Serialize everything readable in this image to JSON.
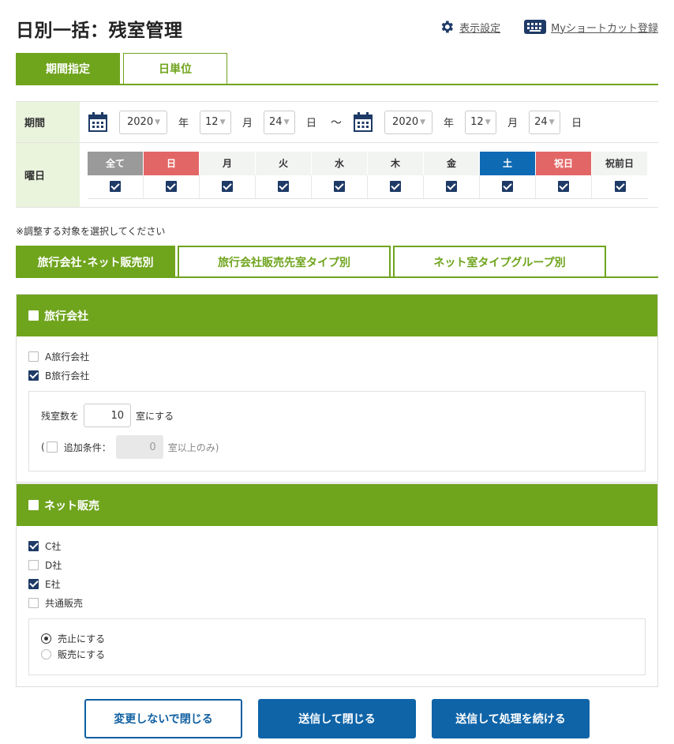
{
  "page": {
    "title": "日別一括：残室管理"
  },
  "top_links": {
    "display_settings": "表示設定",
    "shortcut": "Myショートカット登録"
  },
  "mode_tabs": [
    {
      "label": "期間指定",
      "active": true
    },
    {
      "label": "日単位",
      "active": false
    }
  ],
  "period": {
    "label": "期間",
    "from": {
      "year": "2020",
      "month": "12",
      "day": "24"
    },
    "to": {
      "year": "2020",
      "month": "12",
      "day": "24"
    },
    "unit_year": "年",
    "unit_month": "月",
    "unit_day": "日",
    "tilde": "～"
  },
  "weekdays": {
    "label": "曜日",
    "items": [
      {
        "label": "全て",
        "checked": true
      },
      {
        "label": "日",
        "checked": true
      },
      {
        "label": "月",
        "checked": true
      },
      {
        "label": "火",
        "checked": true
      },
      {
        "label": "水",
        "checked": true
      },
      {
        "label": "木",
        "checked": true
      },
      {
        "label": "金",
        "checked": true
      },
      {
        "label": "土",
        "checked": true
      },
      {
        "label": "祝日",
        "checked": true
      },
      {
        "label": "祝前日",
        "checked": true
      }
    ]
  },
  "note": "※調整する対象を選択してください",
  "target_tabs": [
    {
      "label": "旅行会社･ネット販売別",
      "active": true
    },
    {
      "label": "旅行会社販売先室タイプ別",
      "active": false
    },
    {
      "label": "ネット室タイプグループ別",
      "active": false
    }
  ],
  "agency_panel": {
    "title": "旅行会社",
    "items": [
      {
        "label": "A旅行会社",
        "checked": false
      },
      {
        "label": "B旅行会社",
        "checked": true
      }
    ],
    "rooms_prefix": "残室数を",
    "rooms_value": "10",
    "rooms_suffix": "室にする",
    "extra_open": "(",
    "extra_label": "追加条件：",
    "extra_value": "0",
    "extra_suffix": "室以上のみ)"
  },
  "net_panel": {
    "title": "ネット販売",
    "items": [
      {
        "label": "C社",
        "checked": true
      },
      {
        "label": "D社",
        "checked": false
      },
      {
        "label": "E社",
        "checked": true
      },
      {
        "label": "共通販売",
        "checked": false
      }
    ],
    "radios": [
      {
        "label": "売止にする",
        "selected": true
      },
      {
        "label": "販売にする",
        "selected": false
      }
    ]
  },
  "buttons": {
    "close_no_change": "変更しないで閉じる",
    "submit_close": "送信して閉じる",
    "submit_continue": "送信して処理を続ける"
  },
  "colors": {
    "brand_green": "#6fa41d",
    "header_bg": "#eaf3dc",
    "sunday_holiday": "#e36666",
    "saturday": "#0f6ab4",
    "primary_button": "#0f64a8",
    "checkbox_on": "#1e3a66"
  }
}
